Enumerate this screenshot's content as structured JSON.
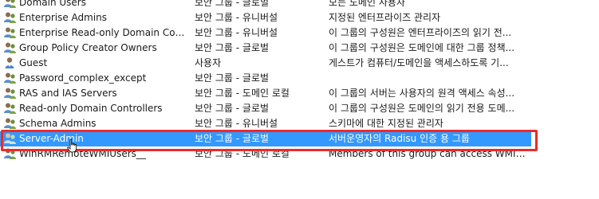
{
  "groups": [
    {
      "name": "Domain Users",
      "type": "보안 그룹 - 글로벌",
      "description": "모든 도메인 사용자",
      "icon": "group-icon"
    },
    {
      "name": "Enterprise Admins",
      "type": "보안 그룹 - 유니버설",
      "description": "지정된 엔터프라이즈 관리자",
      "icon": "group-icon"
    },
    {
      "name": "Enterprise Read-only Domain Contro...",
      "type": "보안 그룹 - 유니버설",
      "description": "이 그룹의 구성원은 엔터프라이즈의 읽기 전...",
      "icon": "group-icon"
    },
    {
      "name": "Group Policy Creator Owners",
      "type": "보안 그룹 - 글로벌",
      "description": "이 그룹의 구성원은 도메인에 대한 그룹 정책...",
      "icon": "group-icon"
    },
    {
      "name": "Guest",
      "type": "사용자",
      "description": "게스트가 컴퓨터/도메인을 액세스하도록 기...",
      "icon": "user-icon"
    },
    {
      "name": "Password_complex_except",
      "type": "보안 그룹 - 글로벌",
      "description": "",
      "icon": "group-icon"
    },
    {
      "name": "RAS and IAS Servers",
      "type": "보안 그룹 - 도메인 로컬",
      "description": "이 그룹의 서버는 사용자의 원격 액세스 속성...",
      "icon": "group-icon"
    },
    {
      "name": "Read-only Domain Controllers",
      "type": "보안 그룹 - 글로벌",
      "description": "이 그룹의 구성원은 도메인의 읽기 전용 도메...",
      "icon": "group-icon"
    },
    {
      "name": "Schema Admins",
      "type": "보안 그룹 - 유니버설",
      "description": "스키마에 대한 지정된 관리자",
      "icon": "group-icon"
    },
    {
      "name": "Server-Admin",
      "type": "보안 그룹 - 글로벌",
      "description": "서버운영자의 Radisu 인증 용 그룹",
      "icon": "group-icon",
      "selected": true
    },
    {
      "name": "WinRMRemoteWMIUsers__",
      "type": "보안 그룹 - 도메인 로컬",
      "description": "Members of this group can access WMI reso...",
      "icon": "group-icon"
    }
  ],
  "colors": {
    "selection": "#3399ff",
    "highlight_outline": "#ee2a2a"
  }
}
